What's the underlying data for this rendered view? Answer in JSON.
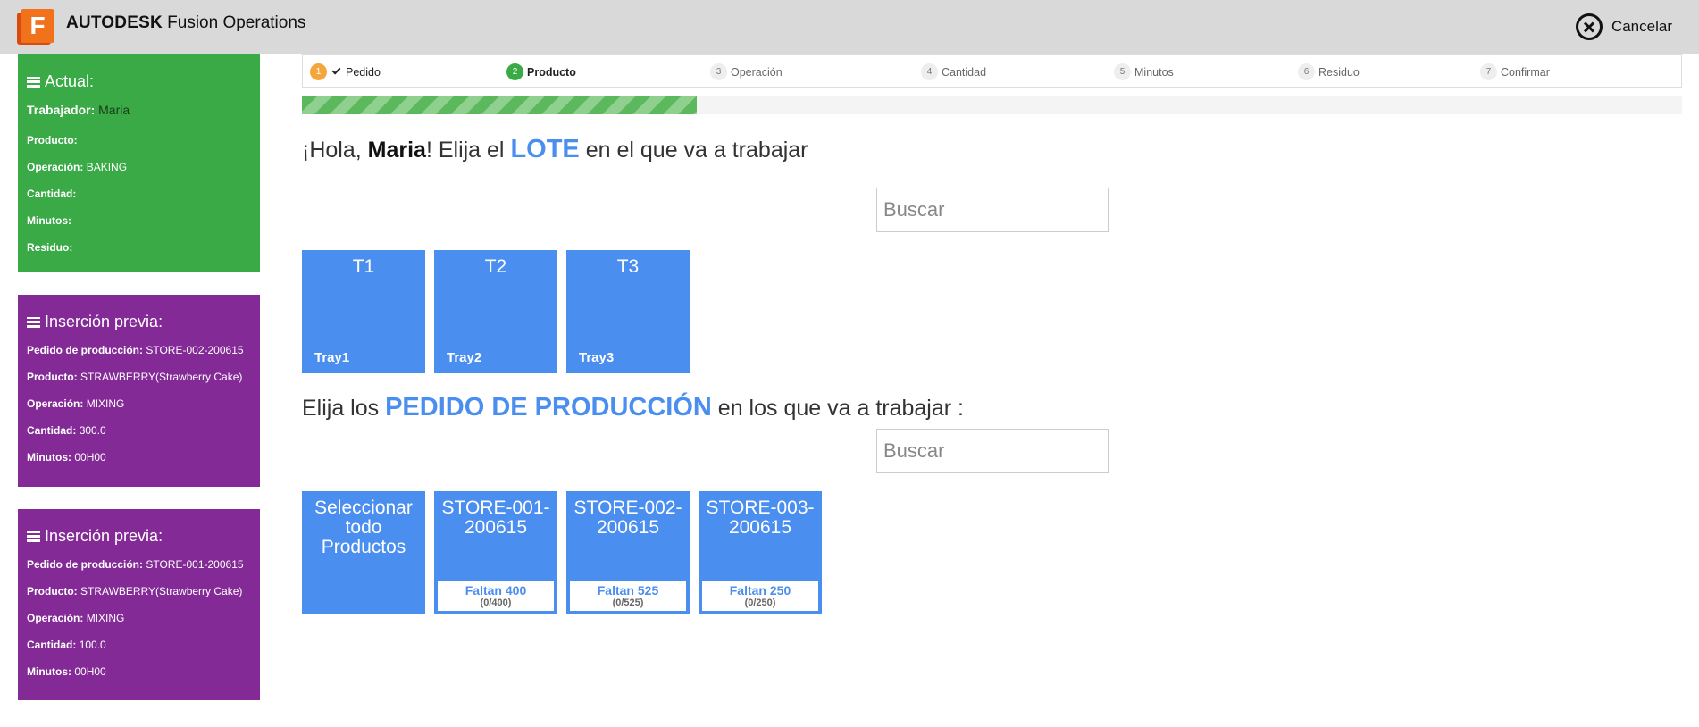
{
  "header": {
    "logo_letter": "F",
    "brand_bold": "AUTODESK",
    "brand_rest": "Fusion Operations",
    "cancel_label": "Cancelar"
  },
  "current": {
    "title": "Actual:",
    "worker_label": "Trabajador:",
    "worker_value": "Maria",
    "product_label": "Producto:",
    "product_value": "",
    "operation_label": "Operación:",
    "operation_value": "BAKING",
    "quantity_label": "Cantidad:",
    "quantity_value": "",
    "minutes_label": "Minutos:",
    "minutes_value": "",
    "waste_label": "Residuo:",
    "waste_value": ""
  },
  "previous": [
    {
      "title": "Inserción previa:",
      "order_label": "Pedido de producción:",
      "order_value": "STORE-002-200615",
      "product_label": "Producto:",
      "product_value": "STRAWBERRY(Strawberry Cake)",
      "operation_label": "Operación:",
      "operation_value": "MIXING",
      "quantity_label": "Cantidad:",
      "quantity_value": "300.0",
      "minutes_label": "Minutos:",
      "minutes_value": "00H00"
    },
    {
      "title": "Inserción previa:",
      "order_label": "Pedido de producción:",
      "order_value": "STORE-001-200615",
      "product_label": "Producto:",
      "product_value": "STRAWBERRY(Strawberry Cake)",
      "operation_label": "Operación:",
      "operation_value": "MIXING",
      "quantity_label": "Cantidad:",
      "quantity_value": "100.0",
      "minutes_label": "Minutos:",
      "minutes_value": "00H00"
    }
  ],
  "steps": [
    {
      "num": "1",
      "label": "Pedido",
      "state": "done"
    },
    {
      "num": "2",
      "label": "Producto",
      "state": "active"
    },
    {
      "num": "3",
      "label": "Operación",
      "state": "pending"
    },
    {
      "num": "4",
      "label": "Cantidad",
      "state": "pending"
    },
    {
      "num": "5",
      "label": "Minutos",
      "state": "pending"
    },
    {
      "num": "6",
      "label": "Residuo",
      "state": "pending"
    },
    {
      "num": "7",
      "label": "Confirmar",
      "state": "pending"
    }
  ],
  "progress_fraction": 0.286,
  "lot_section": {
    "greeting_pre": "¡Hola, ",
    "greeting_name": "Maria",
    "greeting_mid": "! Elija el ",
    "keyword": "LOTE",
    "greeting_post": " en el que va a trabajar",
    "search_placeholder": "Buscar",
    "lots": [
      {
        "code": "T1",
        "name": "Tray1"
      },
      {
        "code": "T2",
        "name": "Tray2"
      },
      {
        "code": "T3",
        "name": "Tray3"
      }
    ]
  },
  "order_section": {
    "pre": "Elija los ",
    "keyword": "PEDIDO DE PRODUCCIÓN",
    "post": " en los que va a trabajar :",
    "search_placeholder": "Buscar",
    "select_all": "Seleccionar todo Productos",
    "orders": [
      {
        "code": "STORE-001-200615",
        "remaining": "Faltan 400",
        "progress": "(0/400)"
      },
      {
        "code": "STORE-002-200615",
        "remaining": "Faltan 525",
        "progress": "(0/525)"
      },
      {
        "code": "STORE-003-200615",
        "remaining": "Faltan 250",
        "progress": "(0/250)"
      }
    ]
  },
  "colors": {
    "accent": "#4a8ef0",
    "current_panel": "#3aaa47",
    "previous_panel": "#832a96",
    "step_done": "#f4a63a",
    "step_active": "#3aaa47"
  }
}
